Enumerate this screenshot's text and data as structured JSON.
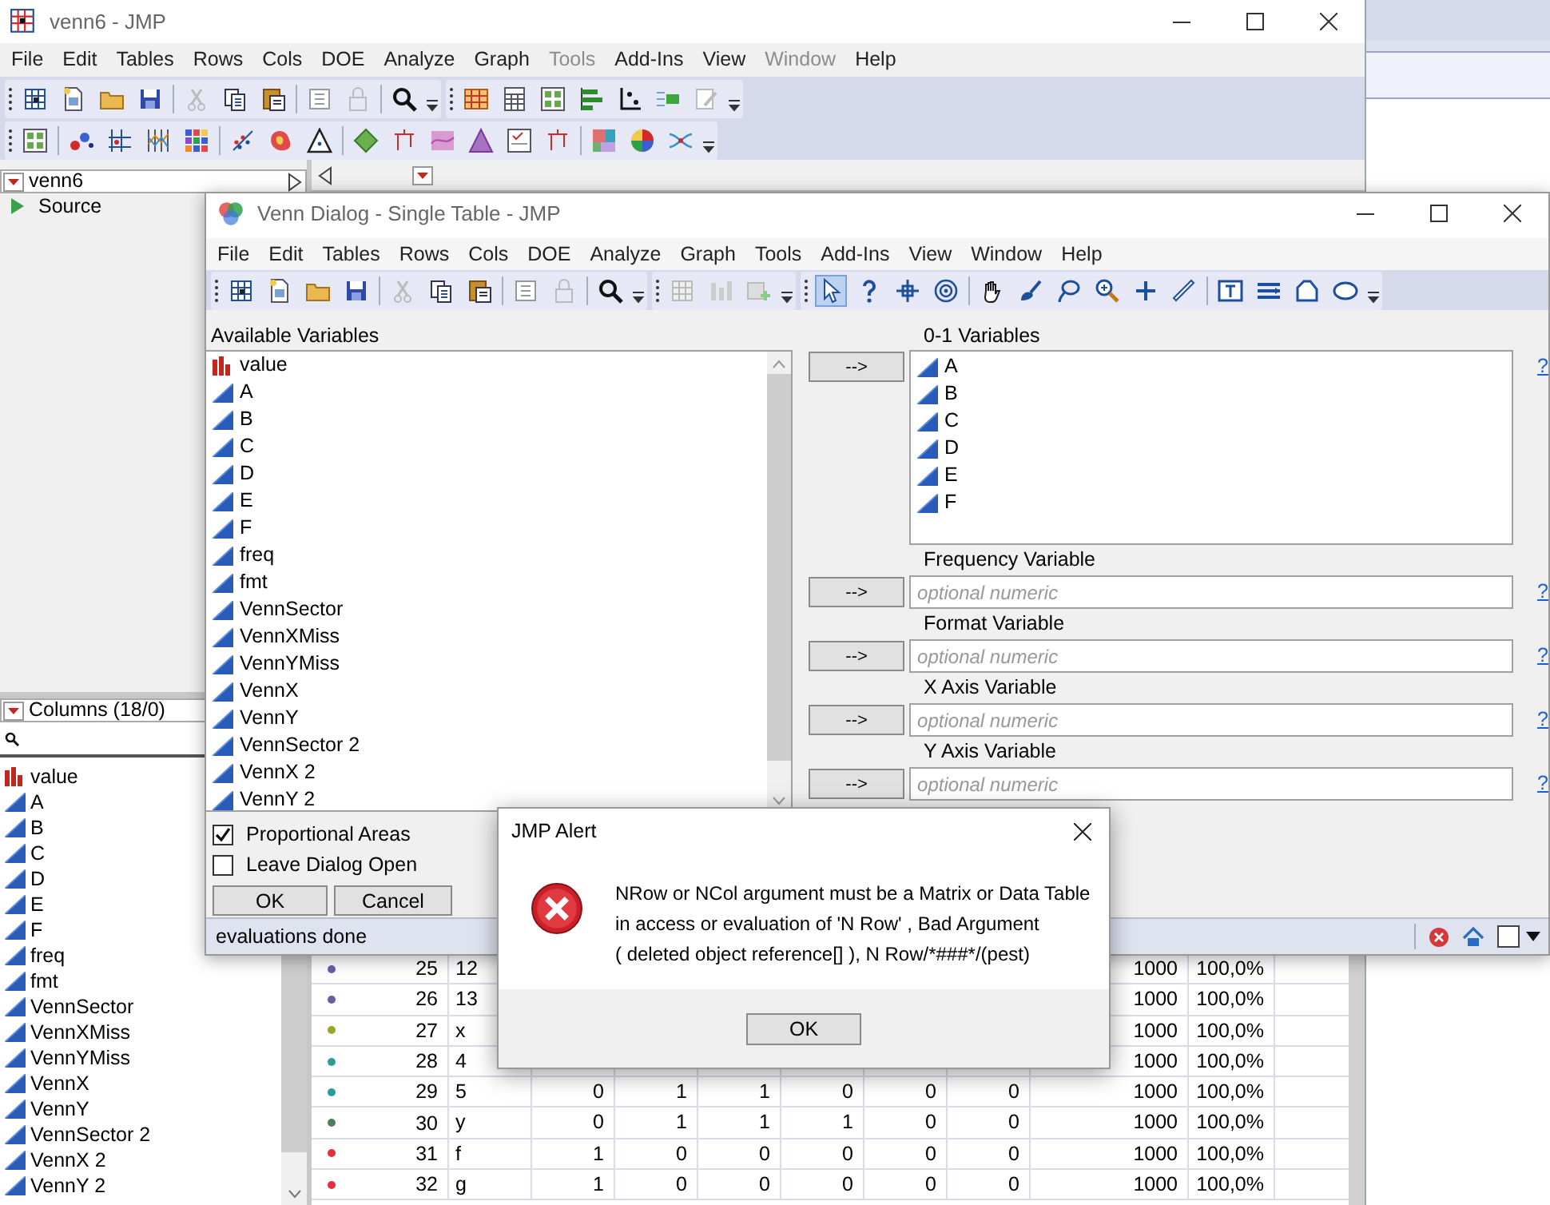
{
  "main_window": {
    "title": "venn6 - JMP",
    "menu": [
      {
        "label": "File",
        "disabled": false
      },
      {
        "label": "Edit",
        "disabled": false
      },
      {
        "label": "Tables",
        "disabled": false
      },
      {
        "label": "Rows",
        "disabled": false
      },
      {
        "label": "Cols",
        "disabled": false
      },
      {
        "label": "DOE",
        "disabled": false
      },
      {
        "label": "Analyze",
        "disabled": false
      },
      {
        "label": "Graph",
        "disabled": false
      },
      {
        "label": "Tools",
        "disabled": true
      },
      {
        "label": "Add-Ins",
        "disabled": false
      },
      {
        "label": "View",
        "disabled": false
      },
      {
        "label": "Window",
        "disabled": true
      },
      {
        "label": "Help",
        "disabled": false
      }
    ],
    "table_panel": {
      "title": "venn6",
      "items": [
        {
          "label": "Source"
        }
      ]
    },
    "columns_panel": {
      "title": "Columns (18/0)",
      "columns": [
        {
          "name": "value",
          "kind": "nominal"
        },
        {
          "name": "A",
          "kind": "continuous"
        },
        {
          "name": "B",
          "kind": "continuous"
        },
        {
          "name": "C",
          "kind": "continuous"
        },
        {
          "name": "D",
          "kind": "continuous"
        },
        {
          "name": "E",
          "kind": "continuous"
        },
        {
          "name": "F",
          "kind": "continuous"
        },
        {
          "name": "freq",
          "kind": "continuous"
        },
        {
          "name": "fmt",
          "kind": "continuous"
        },
        {
          "name": "VennSector",
          "kind": "continuous"
        },
        {
          "name": "VennXMiss",
          "kind": "continuous"
        },
        {
          "name": "VennYMiss",
          "kind": "continuous"
        },
        {
          "name": "VennX",
          "kind": "continuous"
        },
        {
          "name": "VennY",
          "kind": "continuous"
        },
        {
          "name": "VennSector 2",
          "kind": "continuous"
        },
        {
          "name": "VennX 2",
          "kind": "continuous"
        },
        {
          "name": "VennY 2",
          "kind": "continuous"
        }
      ]
    },
    "data_rows": [
      {
        "row": "25",
        "label": "12",
        "color": "#6a5ca8",
        "count": "1000",
        "percent": "100,0%"
      },
      {
        "row": "26",
        "label": "13",
        "color": "#6a5ca8",
        "count": "1000",
        "percent": "100,0%"
      },
      {
        "row": "27",
        "label": "x",
        "color": "#9aa52a",
        "count": "1000",
        "percent": "100,0%"
      },
      {
        "row": "28",
        "label": "4",
        "color": "#2a9d9a",
        "count": "1000",
        "percent": "100,0%"
      },
      {
        "row": "29",
        "label": "5",
        "color": "#2a9d9a",
        "values": [
          "0",
          "1",
          "1",
          "0",
          "0",
          "0"
        ],
        "count": "1000",
        "percent": "100,0%"
      },
      {
        "row": "30",
        "label": "y",
        "color": "#4e7e5e",
        "values": [
          "0",
          "1",
          "1",
          "1",
          "0",
          "0"
        ],
        "count": "1000",
        "percent": "100,0%"
      },
      {
        "row": "31",
        "label": "f",
        "color": "#e3303c",
        "values": [
          "1",
          "0",
          "0",
          "0",
          "0",
          "0"
        ],
        "count": "1000",
        "percent": "100,0%"
      },
      {
        "row": "32",
        "label": "g",
        "color": "#e3303c",
        "values": [
          "1",
          "0",
          "0",
          "0",
          "0",
          "0"
        ],
        "count": "1000",
        "percent": "100,0%"
      }
    ]
  },
  "venn_dialog": {
    "title": "Venn Dialog - Single Table - JMP",
    "menu": [
      {
        "label": "File",
        "disabled": false
      },
      {
        "label": "Edit",
        "disabled": false
      },
      {
        "label": "Tables",
        "disabled": false
      },
      {
        "label": "Rows",
        "disabled": false
      },
      {
        "label": "Cols",
        "disabled": false
      },
      {
        "label": "DOE",
        "disabled": false
      },
      {
        "label": "Analyze",
        "disabled": false
      },
      {
        "label": "Graph",
        "disabled": false
      },
      {
        "label": "Tools",
        "disabled": false
      },
      {
        "label": "Add-Ins",
        "disabled": false
      },
      {
        "label": "View",
        "disabled": false
      },
      {
        "label": "Window",
        "disabled": false
      },
      {
        "label": "Help",
        "disabled": false
      }
    ],
    "tools": [
      {
        "selected": true
      },
      {
        "selected": false
      },
      {
        "selected": false
      },
      {
        "selected": false
      },
      {
        "selected": false
      },
      {
        "selected": false
      },
      {
        "selected": false
      },
      {
        "selected": false
      },
      {
        "selected": false
      },
      {
        "selected": false
      },
      {
        "selected": false
      },
      {
        "selected": false
      },
      {
        "selected": false
      },
      {
        "selected": false
      }
    ],
    "available_label": "Available Variables",
    "available": [
      {
        "name": "value",
        "kind": "nominal"
      },
      {
        "name": "A",
        "kind": "continuous"
      },
      {
        "name": "B",
        "kind": "continuous"
      },
      {
        "name": "C",
        "kind": "continuous"
      },
      {
        "name": "D",
        "kind": "continuous"
      },
      {
        "name": "E",
        "kind": "continuous"
      },
      {
        "name": "F",
        "kind": "continuous"
      },
      {
        "name": "freq",
        "kind": "continuous"
      },
      {
        "name": "fmt",
        "kind": "continuous"
      },
      {
        "name": "VennSector",
        "kind": "continuous"
      },
      {
        "name": "VennXMiss",
        "kind": "continuous"
      },
      {
        "name": "VennYMiss",
        "kind": "continuous"
      },
      {
        "name": "VennX",
        "kind": "continuous"
      },
      {
        "name": "VennY",
        "kind": "continuous"
      },
      {
        "name": "VennSector 2",
        "kind": "continuous"
      },
      {
        "name": "VennX 2",
        "kind": "continuous"
      },
      {
        "name": "VennY 2",
        "kind": "continuous"
      }
    ],
    "options": [
      {
        "label": "Proportional Areas",
        "checked": true
      },
      {
        "label": "Leave Dialog Open",
        "checked": false
      }
    ],
    "buttons": [
      "OK",
      "Cancel"
    ],
    "roles": [
      {
        "label": "0-1 Variables",
        "kind": "list",
        "button": "-->",
        "help": "?",
        "items": [
          {
            "name": "A",
            "kind": "continuous"
          },
          {
            "name": "B",
            "kind": "continuous"
          },
          {
            "name": "C",
            "kind": "continuous"
          },
          {
            "name": "D",
            "kind": "continuous"
          },
          {
            "name": "E",
            "kind": "continuous"
          },
          {
            "name": "F",
            "kind": "continuous"
          }
        ]
      },
      {
        "label": "Frequency Variable",
        "kind": "field",
        "button": "-->",
        "help": "?",
        "placeholder": "optional numeric"
      },
      {
        "label": "Format Variable",
        "kind": "field",
        "button": "-->",
        "help": "?",
        "placeholder": "optional numeric"
      },
      {
        "label": "X Axis Variable",
        "kind": "field",
        "button": "-->",
        "help": "?",
        "placeholder": "optional numeric"
      },
      {
        "label": "Y Axis Variable",
        "kind": "field",
        "button": "-->",
        "help": "?",
        "placeholder": "optional numeric"
      }
    ],
    "status": "evaluations done"
  },
  "alert": {
    "title": "JMP Alert",
    "message": "NRow or NCol argument must be a Matrix or Data Table\nin access or evaluation of 'N Row' , Bad Argument\n( deleted object reference[] ), N Row/*###*/(pest)",
    "button": "OK"
  }
}
